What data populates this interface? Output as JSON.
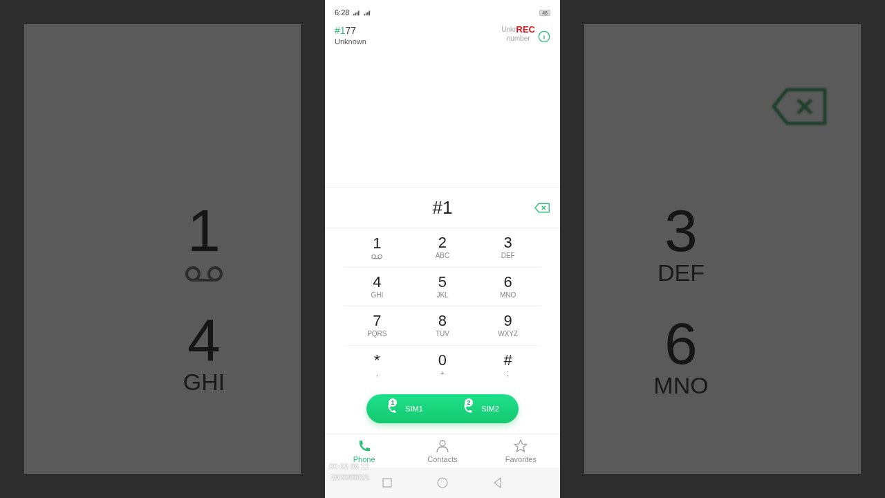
{
  "backdrop": {
    "left": [
      {
        "digit": "1",
        "kind": "voicemail"
      },
      {
        "digit": "4",
        "kind": "letters",
        "letters": "GHI"
      }
    ],
    "right": [
      {
        "digit": "3",
        "kind": "letters",
        "letters": "DEF"
      },
      {
        "digit": "6",
        "kind": "letters",
        "letters": "MNO"
      }
    ]
  },
  "status_bar": {
    "time": "6:28",
    "battery": "48"
  },
  "header": {
    "number_match": "#1",
    "number_rest": "77",
    "label": "Unknown",
    "caller_line1": "Unkn",
    "caller_line2": "number",
    "rec": "REC"
  },
  "display": {
    "value": "#1"
  },
  "keys": [
    {
      "digit": "1",
      "kind": "voicemail"
    },
    {
      "digit": "2",
      "kind": "letters",
      "letters": "ABC"
    },
    {
      "digit": "3",
      "kind": "letters",
      "letters": "DEF"
    },
    {
      "digit": "4",
      "kind": "letters",
      "letters": "GHI"
    },
    {
      "digit": "5",
      "kind": "letters",
      "letters": "JKL"
    },
    {
      "digit": "6",
      "kind": "letters",
      "letters": "MNO"
    },
    {
      "digit": "7",
      "kind": "letters",
      "letters": "PQRS"
    },
    {
      "digit": "8",
      "kind": "letters",
      "letters": "TUV"
    },
    {
      "digit": "9",
      "kind": "letters",
      "letters": "WXYZ"
    },
    {
      "digit": "*",
      "kind": "letters",
      "letters": ","
    },
    {
      "digit": "0",
      "kind": "letters",
      "letters": "+"
    },
    {
      "digit": "#",
      "kind": "letters",
      "letters": ";"
    }
  ],
  "call_buttons": [
    {
      "label": "SIM1",
      "badge": "1"
    },
    {
      "label": "SIM2",
      "badge": "2"
    }
  ],
  "tabs": [
    {
      "label": "Phone",
      "kind": "phone",
      "selected": true
    },
    {
      "label": "Contacts",
      "kind": "person",
      "selected": false
    },
    {
      "label": "Favorites",
      "kind": "star",
      "selected": false
    }
  ],
  "overlay": {
    "timecode": "00 00 05 11",
    "date": "2020/08/22"
  }
}
